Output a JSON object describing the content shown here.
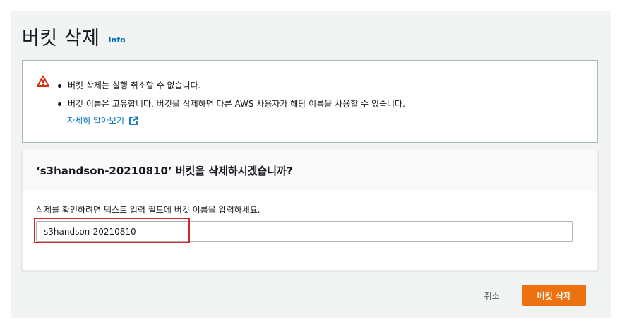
{
  "header": {
    "title": "버킷 삭제",
    "info_label": "Info"
  },
  "alert": {
    "icon": "warning-icon",
    "items": [
      "버킷 삭제는 실행 취소할 수 없습니다.",
      "버킷 이름은 고유합니다. 버킷을 삭제하면 다른 AWS 사용자가 해당 이름을 사용할 수 있습니다."
    ],
    "learn_more": "자세히 알아보기",
    "link_icon": "external-link-icon"
  },
  "confirm": {
    "title": "‘s3handson-20210810’ 버킷을 삭제하시겠습니까?",
    "hint": "삭제를 확인하려면 텍스트 입력 필드에 버킷 이름을 입력하세요.",
    "input_value": "s3handson-20210810"
  },
  "actions": {
    "cancel_label": "취소",
    "delete_label": "버킷 삭제"
  },
  "colors": {
    "accent": "#ec7211",
    "link": "#0073bb",
    "warning": "#d13212",
    "highlight": "#d9242c"
  }
}
